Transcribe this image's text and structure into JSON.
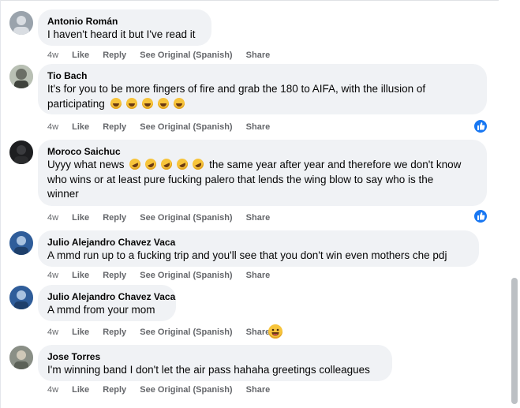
{
  "comments": [
    {
      "author": "Antonio Román",
      "text": "I haven't heard it but I've read it",
      "time": "4w"
    },
    {
      "author": "Tio Bach",
      "text_line1": "It's for you to be more fingers of fire and grab the 180 to AIFA, with the illusion of",
      "text_line2": "participating",
      "time": "4w"
    },
    {
      "author": "Moroco Saichuc",
      "text_line1a": "Uyyy what news",
      "text_line1b": "the same year after year and therefore we don't know",
      "text_line2": "who wins or at least pure fucking palero that lends the wing blow to say who is the",
      "text_line3": "winner",
      "time": "4w"
    },
    {
      "author": "Julio Alejandro Chavez Vaca",
      "text": "A mmd run up to a fucking trip and you'll see that you don't win even mothers che pdj",
      "time": "4w"
    },
    {
      "author": "Julio Alejandro Chavez Vaca",
      "text": "A mmd from your mom",
      "time": "4w"
    },
    {
      "author": "Jose Torres",
      "text": "I'm winning band I don't let the air pass hahaha greetings colleagues",
      "time": "4w"
    }
  ],
  "actions": {
    "like": "Like",
    "reply": "Reply",
    "see_original": "See Original (Spanish)",
    "share": "Share"
  },
  "icons": {
    "like_badge": "thumbs-up-icon",
    "laugh_emoji": "laughing-emoji-icon",
    "rofl_emoji": "rofl-emoji-icon",
    "haha_reaction": "haha-reaction-icon"
  },
  "colors": {
    "bubble": "#f0f2f5",
    "action_text": "#65676b",
    "like_blue": "#1877f2"
  }
}
